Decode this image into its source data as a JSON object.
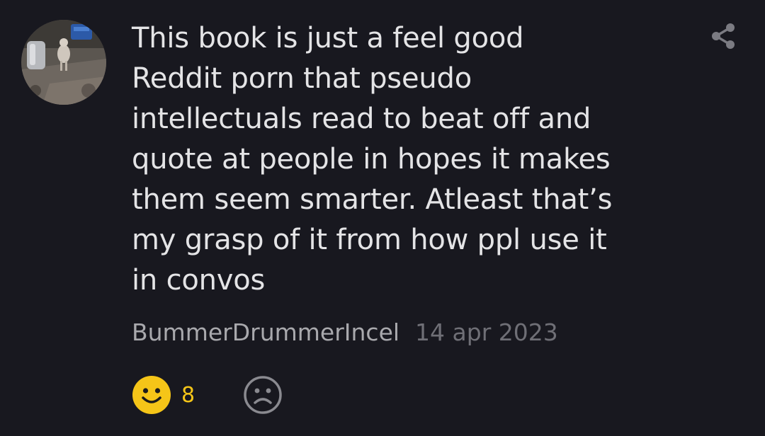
{
  "comment": {
    "text": "This book is just a feel good\nReddit porn that pseudo\nintellectuals read to beat off and\nquote at people in hopes it makes\nthem seem smarter. Atleast that’s\nmy grasp of it from how ppl use it\nin convos",
    "author": "BummerDrummerIncel",
    "date": "14 apr 2023"
  },
  "reactions": {
    "like_icon": "smiley-face-icon",
    "like_count": "8",
    "dislike_icon": "sad-face-icon"
  },
  "actions": {
    "share_icon": "share-icon"
  },
  "colors": {
    "background": "#18181f",
    "text": "#e4e4e6",
    "author": "#a9a9ad",
    "date": "#6f6f76",
    "like_accent": "#f5c518",
    "dislike_icon": "#8a8a90"
  }
}
